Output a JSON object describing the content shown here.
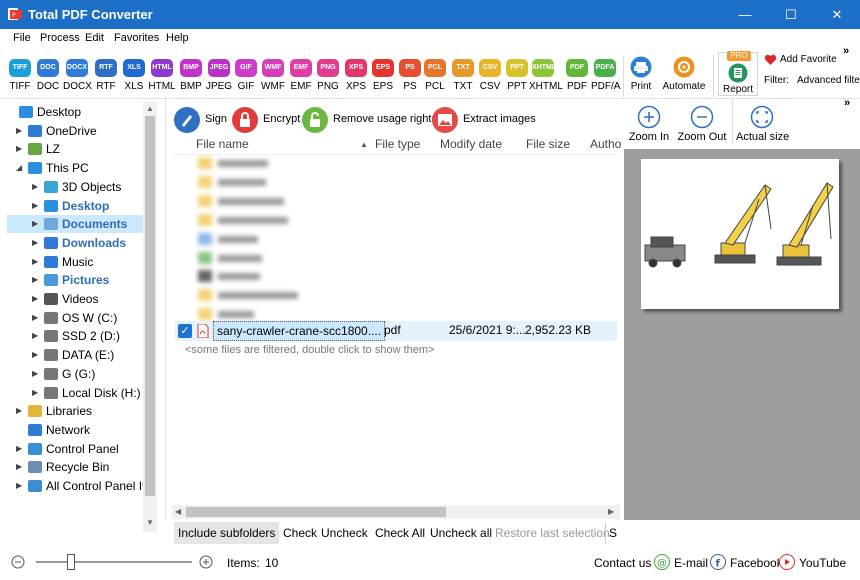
{
  "window": {
    "title": "Total PDF Converter",
    "minimize": "—",
    "maximize": "☐",
    "close": "✕"
  },
  "menu": [
    "File",
    "Process",
    "Edit",
    "Favorites",
    "Help"
  ],
  "formats": [
    {
      "label": "TIFF",
      "icon_text": "TIFF",
      "color": "#1a9fd8"
    },
    {
      "label": "DOC",
      "icon_text": "DOC",
      "color": "#2f7bd6"
    },
    {
      "label": "DOCX",
      "icon_text": "DOCX",
      "color": "#2f7bd6"
    },
    {
      "label": "RTF",
      "icon_text": "RTF",
      "color": "#2f6fc4"
    },
    {
      "label": "XLS",
      "icon_text": "XLS",
      "color": "#1f6bd0"
    },
    {
      "label": "HTML",
      "icon_text": "HTML",
      "color": "#8e3ad0"
    },
    {
      "label": "BMP",
      "icon_text": "BMP",
      "color": "#c033c9"
    },
    {
      "label": "JPEG",
      "icon_text": "JPEG",
      "color": "#b832c4"
    },
    {
      "label": "GIF",
      "icon_text": "GIF",
      "color": "#cf3cc7"
    },
    {
      "label": "WMF",
      "icon_text": "WMF",
      "color": "#d43fba"
    },
    {
      "label": "EMF",
      "icon_text": "EMF",
      "color": "#dd3fa6"
    },
    {
      "label": "PNG",
      "icon_text": "PNG",
      "color": "#e03c8f"
    },
    {
      "label": "XPS",
      "icon_text": "XPS",
      "color": "#e2356a"
    },
    {
      "label": "EPS",
      "icon_text": "EPS",
      "color": "#e3342f"
    },
    {
      "label": "PS",
      "icon_text": "PS",
      "color": "#e4512c"
    },
    {
      "label": "PCL",
      "icon_text": "PCL",
      "color": "#e5752b"
    },
    {
      "label": "TXT",
      "icon_text": "TXT",
      "color": "#e7982a"
    },
    {
      "label": "CSV",
      "icon_text": "CSV",
      "color": "#e8b42a"
    },
    {
      "label": "PPT",
      "icon_text": "PPT",
      "color": "#d7c22a"
    },
    {
      "label": "XHTML",
      "icon_text": "XHTML",
      "color": "#8bc43a"
    },
    {
      "label": "PDF",
      "icon_text": "PDF",
      "color": "#62b63a"
    },
    {
      "label": "PDF/A",
      "icon_text": "PDFA",
      "color": "#49b04a"
    }
  ],
  "toolbar": {
    "print": "Print",
    "automate": "Automate",
    "report": "Report",
    "pro_badge": "PRO",
    "add_favorite": "Add Favorite",
    "filter_label": "Filter:",
    "filter_value": "Advanced filte",
    "more": "»"
  },
  "tree": [
    {
      "label": "Desktop",
      "level": 0,
      "arrow": "",
      "icon": "desktop-icon",
      "selected": false,
      "blue": false
    },
    {
      "label": "OneDrive",
      "level": 1,
      "arrow": "▶",
      "icon": "cloud-icon",
      "selected": false,
      "blue": false
    },
    {
      "label": "LZ",
      "level": 1,
      "arrow": "▶",
      "icon": "user-icon",
      "selected": false,
      "blue": false
    },
    {
      "label": "This PC",
      "level": 1,
      "arrow": "◢",
      "icon": "computer-icon",
      "selected": false,
      "blue": false
    },
    {
      "label": "3D Objects",
      "level": 2,
      "arrow": "▶",
      "icon": "cube-icon",
      "selected": false,
      "blue": false
    },
    {
      "label": "Desktop",
      "level": 2,
      "arrow": "▶",
      "icon": "desktop-icon",
      "selected": false,
      "blue": true
    },
    {
      "label": "Documents",
      "level": 2,
      "arrow": "▶",
      "icon": "documents-icon",
      "selected": true,
      "blue": true
    },
    {
      "label": "Downloads",
      "level": 2,
      "arrow": "▶",
      "icon": "download-icon",
      "selected": false,
      "blue": true
    },
    {
      "label": "Music",
      "level": 2,
      "arrow": "▶",
      "icon": "music-icon",
      "selected": false,
      "blue": false
    },
    {
      "label": "Pictures",
      "level": 2,
      "arrow": "▶",
      "icon": "pictures-icon",
      "selected": false,
      "blue": true
    },
    {
      "label": "Videos",
      "level": 2,
      "arrow": "▶",
      "icon": "videos-icon",
      "selected": false,
      "blue": false
    },
    {
      "label": "OS W (C:)",
      "level": 2,
      "arrow": "▶",
      "icon": "drive-icon",
      "selected": false,
      "blue": false
    },
    {
      "label": "SSD 2 (D:)",
      "level": 2,
      "arrow": "▶",
      "icon": "drive-icon",
      "selected": false,
      "blue": false
    },
    {
      "label": "DATA (E:)",
      "level": 2,
      "arrow": "▶",
      "icon": "drive-icon",
      "selected": false,
      "blue": false
    },
    {
      "label": "G (G:)",
      "level": 2,
      "arrow": "▶",
      "icon": "drive-icon",
      "selected": false,
      "blue": false
    },
    {
      "label": "Local Disk (H:)",
      "level": 2,
      "arrow": "▶",
      "icon": "drive-icon",
      "selected": false,
      "blue": false
    },
    {
      "label": "Libraries",
      "level": 1,
      "arrow": "▶",
      "icon": "libraries-icon",
      "selected": false,
      "blue": false
    },
    {
      "label": "Network",
      "level": 1,
      "arrow": "",
      "icon": "network-icon",
      "selected": false,
      "blue": false
    },
    {
      "label": "Control Panel",
      "level": 1,
      "arrow": "▶",
      "icon": "control-panel-icon",
      "selected": false,
      "blue": false
    },
    {
      "label": "Recycle Bin",
      "level": 1,
      "arrow": "▶",
      "icon": "recycle-bin-icon",
      "selected": false,
      "blue": false
    },
    {
      "label": "All Control Panel Ite",
      "level": 1,
      "arrow": "▶",
      "icon": "control-panel-icon",
      "selected": false,
      "blue": false
    }
  ],
  "actions": {
    "sign": "Sign",
    "encrypt": "Encrypt",
    "remove_rights": "Remove usage rights",
    "extract_images": "Extract images",
    "more": "»"
  },
  "columns": {
    "name": "File name",
    "type": "File type",
    "modify": "Modify date",
    "size": "File size",
    "author": "Autho"
  },
  "file": {
    "name": "sany-crawler-crane-scc1800....",
    "type": "pdf",
    "date": "25/6/2021 9:...",
    "size": "2,952.23 KB",
    "checked": true
  },
  "filtered_note": "<some files are filtered, double click to show them>",
  "bottom_tabs": {
    "include": "Include subfolders",
    "check": "Check",
    "uncheck": "Uncheck",
    "check_all": "Check All",
    "uncheck_all": "Uncheck all",
    "restore": "Restore last selection",
    "more": "S"
  },
  "preview": {
    "zoom_in": "Zoom In",
    "zoom_out": "Zoom Out",
    "actual_size": "Actual size"
  },
  "status": {
    "items_label": "Items:",
    "items_count": "10",
    "zoom_level": 0.2,
    "contact": "Contact us",
    "email": "E-mail",
    "facebook": "Facebook",
    "youtube": "YouTube"
  }
}
